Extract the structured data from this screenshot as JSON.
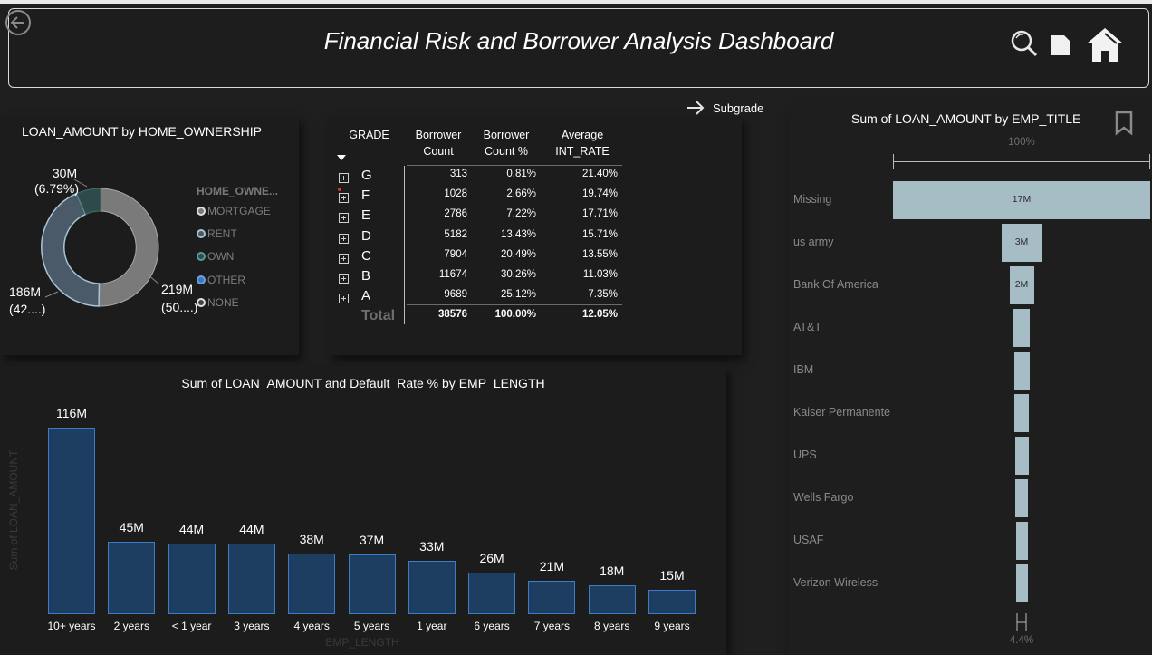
{
  "header": {
    "title": "Financial Risk and Borrower Analysis Dashboard"
  },
  "icons": {
    "back": "back-arrow-icon",
    "search": "search-icon",
    "page": "document-icon",
    "home": "home-icon"
  },
  "drill": {
    "label": "Subgrade"
  },
  "donut": {
    "title": "LOAN_AMOUNT by HOME_OWNERSHIP",
    "legend_title": "HOME_OWNE...",
    "legend": [
      "MORTGAGE",
      "RENT",
      "OWN",
      "OTHER",
      "NONE"
    ],
    "labels": {
      "own_value": "30M",
      "own_pct": "(6.79%)",
      "rent_value": "186M",
      "rent_pct": "(42....)",
      "mortgage_value": "219M",
      "mortgage_pct": "(50....)"
    }
  },
  "grade_table": {
    "headers": {
      "grade": "GRADE",
      "count": "Borrower Count",
      "count_pct": "Borrower Count %",
      "rate": "Average INT_RATE"
    },
    "rows": [
      {
        "grade": "G",
        "count": "313",
        "pct": "0.81%",
        "rate": "21.40%"
      },
      {
        "grade": "F",
        "count": "1028",
        "pct": "2.66%",
        "rate": "19.74%"
      },
      {
        "grade": "E",
        "count": "2786",
        "pct": "7.22%",
        "rate": "17.71%"
      },
      {
        "grade": "D",
        "count": "5182",
        "pct": "13.43%",
        "rate": "15.71%"
      },
      {
        "grade": "C",
        "count": "7904",
        "pct": "20.49%",
        "rate": "13.55%"
      },
      {
        "grade": "B",
        "count": "11674",
        "pct": "30.26%",
        "rate": "11.03%"
      },
      {
        "grade": "A",
        "count": "9689",
        "pct": "25.12%",
        "rate": "7.35%"
      }
    ],
    "total": {
      "label": "Total",
      "count": "38576",
      "pct": "100.00%",
      "rate": "12.05%"
    }
  },
  "emp_title": {
    "title": "Sum of LOAN_AMOUNT by EMP_TITLE",
    "top_pct": "100%",
    "bottom_pct": "4.4%",
    "items": [
      {
        "name": "Missing",
        "label": "17M"
      },
      {
        "name": "us army",
        "label": "3M"
      },
      {
        "name": "Bank Of America",
        "label": "2M"
      },
      {
        "name": "AT&T",
        "label": ""
      },
      {
        "name": "IBM",
        "label": ""
      },
      {
        "name": "Kaiser Permanente",
        "label": ""
      },
      {
        "name": "UPS",
        "label": ""
      },
      {
        "name": "Wells Fargo",
        "label": ""
      },
      {
        "name": "USAF",
        "label": ""
      },
      {
        "name": "Verizon Wireless",
        "label": ""
      }
    ]
  },
  "chart_data": {
    "type": "bar",
    "title": "Sum of LOAN_AMOUNT and Default_Rate % by EMP_LENGTH",
    "xlabel": "EMP_LENGTH",
    "ylabel": "Sum of LOAN_AMOUNT",
    "categories": [
      "10+ years",
      "2 years",
      "< 1 year",
      "3 years",
      "4 years",
      "5 years",
      "1 year",
      "6 years",
      "7 years",
      "8 years",
      "9 years"
    ],
    "values": [
      116,
      45,
      44,
      44,
      38,
      37,
      33,
      26,
      21,
      18,
      15
    ],
    "labels": [
      "116M",
      "45M",
      "44M",
      "44M",
      "38M",
      "37M",
      "33M",
      "26M",
      "21M",
      "18M",
      "15M"
    ],
    "unit": "M",
    "ylim": [
      0,
      116
    ],
    "grid": false,
    "bar_color": "#1d3d61"
  }
}
